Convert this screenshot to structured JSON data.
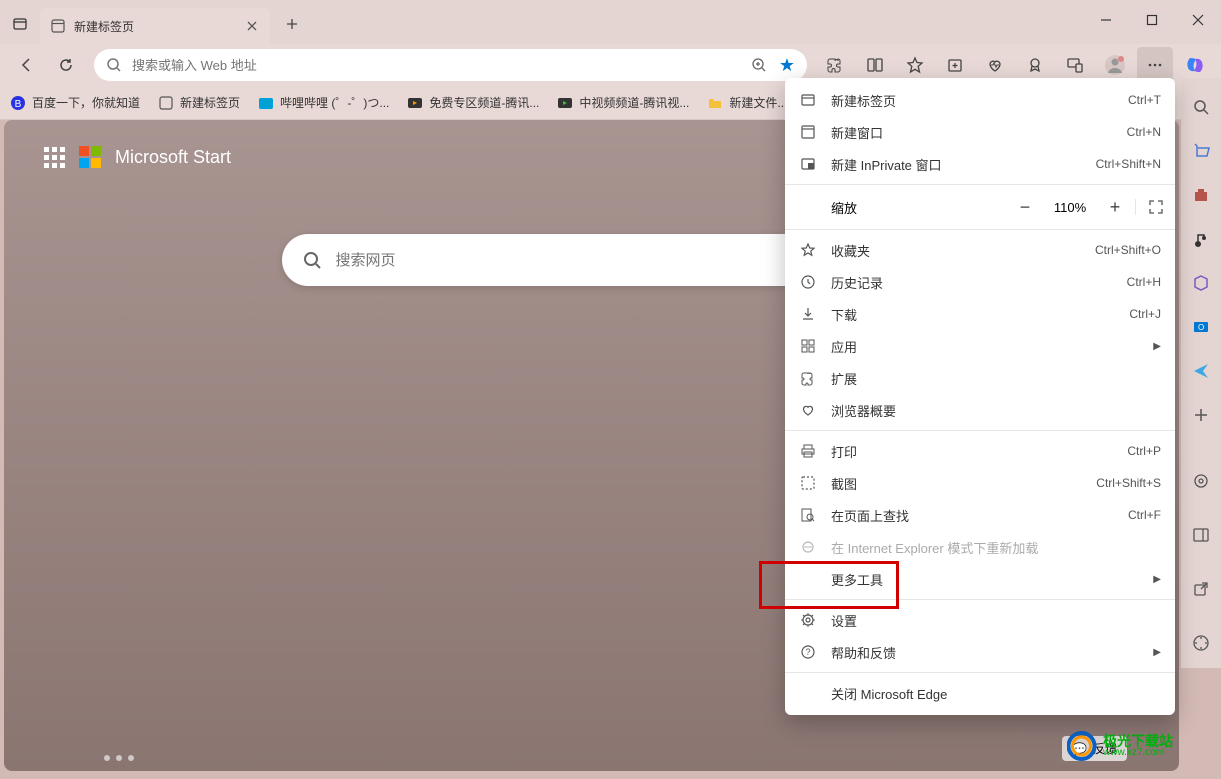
{
  "tab": {
    "title": "新建标签页"
  },
  "addressbar": {
    "placeholder": "搜索或输入 Web 地址"
  },
  "bookmarks": [
    {
      "label": "百度一下，你就知道",
      "icon": "baidu"
    },
    {
      "label": "新建标签页",
      "icon": "page"
    },
    {
      "label": "哔哩哔哩 (゜-゜)つ...",
      "icon": "bili"
    },
    {
      "label": "免费专区频道-腾讯...",
      "icon": "video"
    },
    {
      "label": "中视频频道-腾讯视...",
      "icon": "video"
    },
    {
      "label": "新建文件...",
      "icon": "folder"
    }
  ],
  "content": {
    "brand": "Microsoft Start",
    "search_placeholder": "搜索网页"
  },
  "menu": {
    "new_tab": {
      "label": "新建标签页",
      "shortcut": "Ctrl+T"
    },
    "new_window": {
      "label": "新建窗口",
      "shortcut": "Ctrl+N"
    },
    "new_inprivate": {
      "label": "新建 InPrivate 窗口",
      "shortcut": "Ctrl+Shift+N"
    },
    "zoom": {
      "label": "缩放",
      "value": "110%"
    },
    "favorites": {
      "label": "收藏夹",
      "shortcut": "Ctrl+Shift+O"
    },
    "history": {
      "label": "历史记录",
      "shortcut": "Ctrl+H"
    },
    "downloads": {
      "label": "下载",
      "shortcut": "Ctrl+J"
    },
    "apps": {
      "label": "应用"
    },
    "extensions": {
      "label": "扩展"
    },
    "browser_essentials": {
      "label": "浏览器概要"
    },
    "print": {
      "label": "打印",
      "shortcut": "Ctrl+P"
    },
    "screenshot": {
      "label": "截图",
      "shortcut": "Ctrl+Shift+S"
    },
    "find": {
      "label": "在页面上查找",
      "shortcut": "Ctrl+F"
    },
    "ie_mode": {
      "label": "在 Internet Explorer 模式下重新加载"
    },
    "more_tools": {
      "label": "更多工具"
    },
    "settings": {
      "label": "设置"
    },
    "help": {
      "label": "帮助和反馈"
    },
    "close": {
      "label": "关闭 Microsoft Edge"
    }
  },
  "feedback": {
    "label": "反馈"
  },
  "watermark": {
    "cn": "极光下载站",
    "url": "www.xz7.com"
  }
}
